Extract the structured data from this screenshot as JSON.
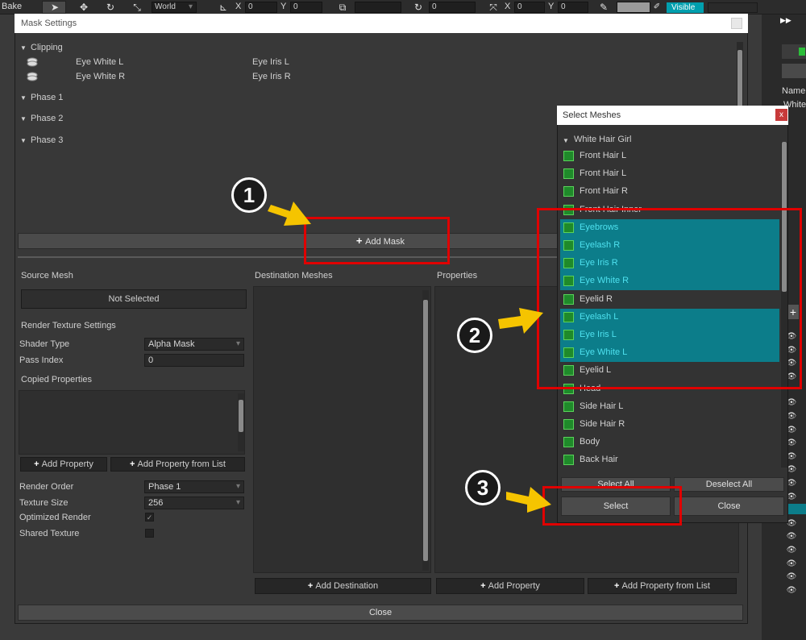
{
  "toolbar": {
    "bake": "Bake",
    "world": "World",
    "x_label": "X",
    "x_value": "0",
    "y_label": "Y",
    "y_value": "0",
    "rot_value": "0",
    "x2_label": "X",
    "x2_value": "0",
    "y2_label": "Y",
    "y2_value": "0",
    "visible": "Visible"
  },
  "right_panel": {
    "name_label": "Name",
    "name_value": "White"
  },
  "mask_window": {
    "title": "Mask Settings",
    "clipping": "Clipping",
    "clip_rows": [
      {
        "left": "Eye White L",
        "right": "Eye Iris L"
      },
      {
        "left": "Eye White R",
        "right": "Eye Iris R"
      }
    ],
    "phases": [
      "Phase 1",
      "Phase 2",
      "Phase 3"
    ],
    "add_mask": "Add Mask",
    "source_mesh_label": "Source Mesh",
    "not_selected": "Not Selected",
    "render_texture_settings": "Render Texture Settings",
    "shader_type_label": "Shader Type",
    "shader_type_value": "Alpha Mask",
    "pass_index_label": "Pass Index",
    "pass_index_value": "0",
    "copied_properties": "Copied Properties",
    "add_property": "Add Property",
    "add_property_from_list": "Add Property from List",
    "render_order_label": "Render Order",
    "render_order_value": "Phase 1",
    "texture_size_label": "Texture Size",
    "texture_size_value": "256",
    "optimized_render_label": "Optimized Render",
    "shared_texture_label": "Shared Texture",
    "destination_meshes": "Destination Meshes",
    "add_destination": "Add Destination",
    "properties": "Properties",
    "add_property_2": "Add Property",
    "add_property_from_list_2": "Add Property from List",
    "close": "Close"
  },
  "select_meshes": {
    "title": "Select Meshes",
    "close_x": "x",
    "root": "White Hair Girl",
    "items": [
      {
        "label": "Front Hair L",
        "selected": false
      },
      {
        "label": "Front Hair L",
        "selected": false
      },
      {
        "label": "Front Hair R",
        "selected": false
      },
      {
        "label": "Front Hair Inner",
        "selected": false
      },
      {
        "label": "Eyebrows",
        "selected": true
      },
      {
        "label": "Eyelash R",
        "selected": true
      },
      {
        "label": "Eye Iris R",
        "selected": true
      },
      {
        "label": "Eye White R",
        "selected": true
      },
      {
        "label": "Eyelid R",
        "selected": false
      },
      {
        "label": "Eyelash L",
        "selected": true
      },
      {
        "label": "Eye Iris L",
        "selected": true
      },
      {
        "label": "Eye White L",
        "selected": true
      },
      {
        "label": "Eyelid L",
        "selected": false
      },
      {
        "label": "Head",
        "selected": false
      },
      {
        "label": "Side Hair L",
        "selected": false
      },
      {
        "label": "Side Hair R",
        "selected": false
      },
      {
        "label": "Body",
        "selected": false
      },
      {
        "label": "Back Hair",
        "selected": false
      }
    ],
    "select_all": "Select All",
    "deselect_all": "Deselect All",
    "select": "Select",
    "close": "Close"
  },
  "annotations": {
    "step1": "1",
    "step2": "2",
    "step3": "3"
  },
  "colors": {
    "selection": "#0c7d8a",
    "selection_text": "#4ee1ef",
    "highlight": "#e00000",
    "arrow": "#f5c400",
    "visible": "#009fae"
  }
}
